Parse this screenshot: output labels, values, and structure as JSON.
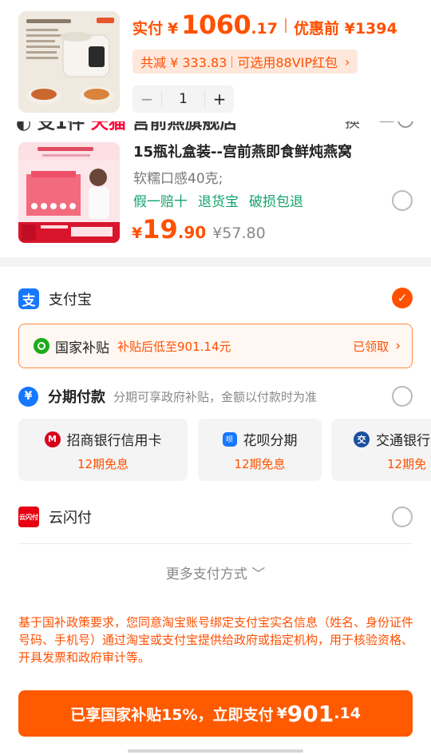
{
  "colors": {
    "accent": "#ff5000",
    "green": "#12a36b",
    "alipay_blue": "#1677ff"
  },
  "top_product": {
    "price_label": "实付",
    "currency": "¥",
    "price_int": "1060",
    "price_dec": ".17",
    "orig_label": "优惠前 ¥1394",
    "save_text": "共减 ¥ 333.83",
    "voucher_text": "可选用88VIP红包",
    "chevron": "›",
    "qty_minus": "−",
    "qty": "1",
    "qty_plus": "+"
  },
  "hidden_row": {
    "text_prefix": "",
    "text_red": "天猫",
    "switch_text": "换一换"
  },
  "product": {
    "title": "15瓶礼盒装--宫前燕即食鲜炖燕窝",
    "subtitle": "软糯口感40克;",
    "tags": [
      "假一赔十",
      "退货宝",
      "破损包退"
    ],
    "currency": "¥",
    "price_int": "19",
    "price_dec": ".90",
    "orig_price": "¥57.80"
  },
  "payment": {
    "alipay_icon": "支",
    "alipay_label": "支付宝",
    "check_glyph": "✓",
    "subsidy": {
      "name": "国家补贴",
      "desc": "补贴后低至901.14元",
      "claim": "已领取",
      "chevron": "›"
    },
    "installment": {
      "icon": "¥",
      "label": "分期付款",
      "note": "分期可享政府补贴，金额以付款时为准",
      "cards": [
        {
          "name": "招商银行信用卡",
          "term": "12期免息"
        },
        {
          "name": "花呗分期",
          "term": "12期免息"
        },
        {
          "name": "交通银行",
          "term": "12期免"
        }
      ]
    },
    "unionpay_label": "云闪付",
    "unionpay_icon": "云闪付",
    "more_label": "更多支付方式 ﹀",
    "notice": "基于国补政策要求，您同意淘宝账号绑定支付宝实名信息（姓名、身份证件号码、手机号）通过淘宝或支付宝提供给政府或指定机构，用于核验资格、开具发票和政府审计等。",
    "pay_button": {
      "text": "已享国家补贴15%，立即支付",
      "currency": "¥",
      "amount_int": "901",
      "amount_dec": ".14"
    }
  }
}
